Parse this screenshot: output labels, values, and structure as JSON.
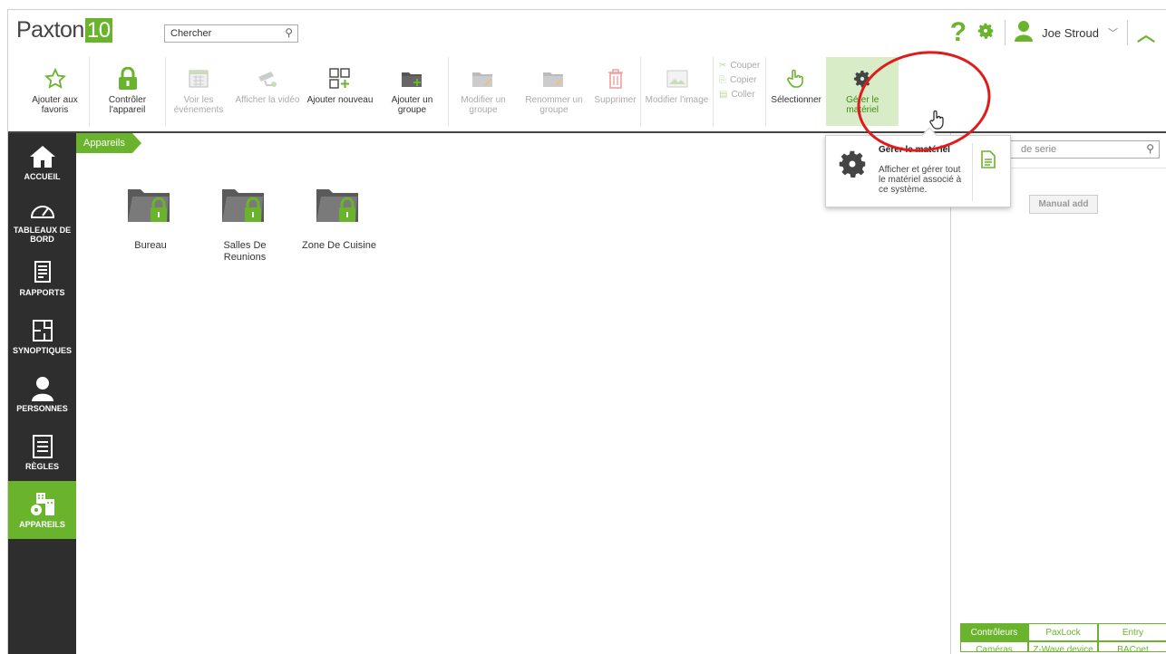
{
  "app": {
    "logo_text": "Paxton",
    "logo_num": "10"
  },
  "search": {
    "placeholder": "Chercher"
  },
  "header": {
    "user_name": "Joe Stroud"
  },
  "ribbon": {
    "favorites": "Ajouter aux\nfavoris",
    "control": "Contrôler\nl'appareil",
    "events": "Voir les\névénements",
    "video": "Afficher la vidéo",
    "add_new": "Ajouter nouveau",
    "add_group": "Ajouter un\ngroupe",
    "edit_group": "Modifier un\ngroupe",
    "rename_group": "Renommer un\ngroupe",
    "delete": "Supprimer",
    "edit_image": "Modifier l'image",
    "cut": "Couper",
    "copy": "Copier",
    "paste": "Coller",
    "select": "Sélectionner",
    "manage_hw": "Gérer le matériel"
  },
  "sidebar": [
    {
      "label": "ACCUEIL",
      "icon": "home-icon"
    },
    {
      "label": "TABLEAUX DE\nBORD",
      "icon": "dashboard-icon"
    },
    {
      "label": "RAPPORTS",
      "icon": "reports-icon"
    },
    {
      "label": "SYNOPTIQUES",
      "icon": "floorplan-icon"
    },
    {
      "label": "PERSONNES",
      "icon": "person-icon"
    },
    {
      "label": "RÈGLES",
      "icon": "rules-icon"
    },
    {
      "label": "APPAREILS",
      "icon": "devices-icon",
      "active": true
    }
  ],
  "breadcrumb": {
    "current": "Appareils"
  },
  "folders": [
    "Bureau",
    "Salles De\nReunions",
    "Zone De Cuisine"
  ],
  "right_panel": {
    "serial_placeholder": "de serie",
    "manual_add": "Manual add",
    "tabs_row1": [
      "Contrôleurs",
      "PaxLock",
      "Entry"
    ],
    "tabs_row2": [
      "Caméras",
      "Z-Wave device",
      "BACnet"
    ]
  },
  "tooltip": {
    "title": "Gérer le matériel",
    "description": "Afficher et gérer tout le matériel associé à ce système."
  },
  "colors": {
    "brand_green": "#6ab42d",
    "sidebar_bg": "#2e2e2e",
    "annotation_red": "#e01b1b"
  }
}
